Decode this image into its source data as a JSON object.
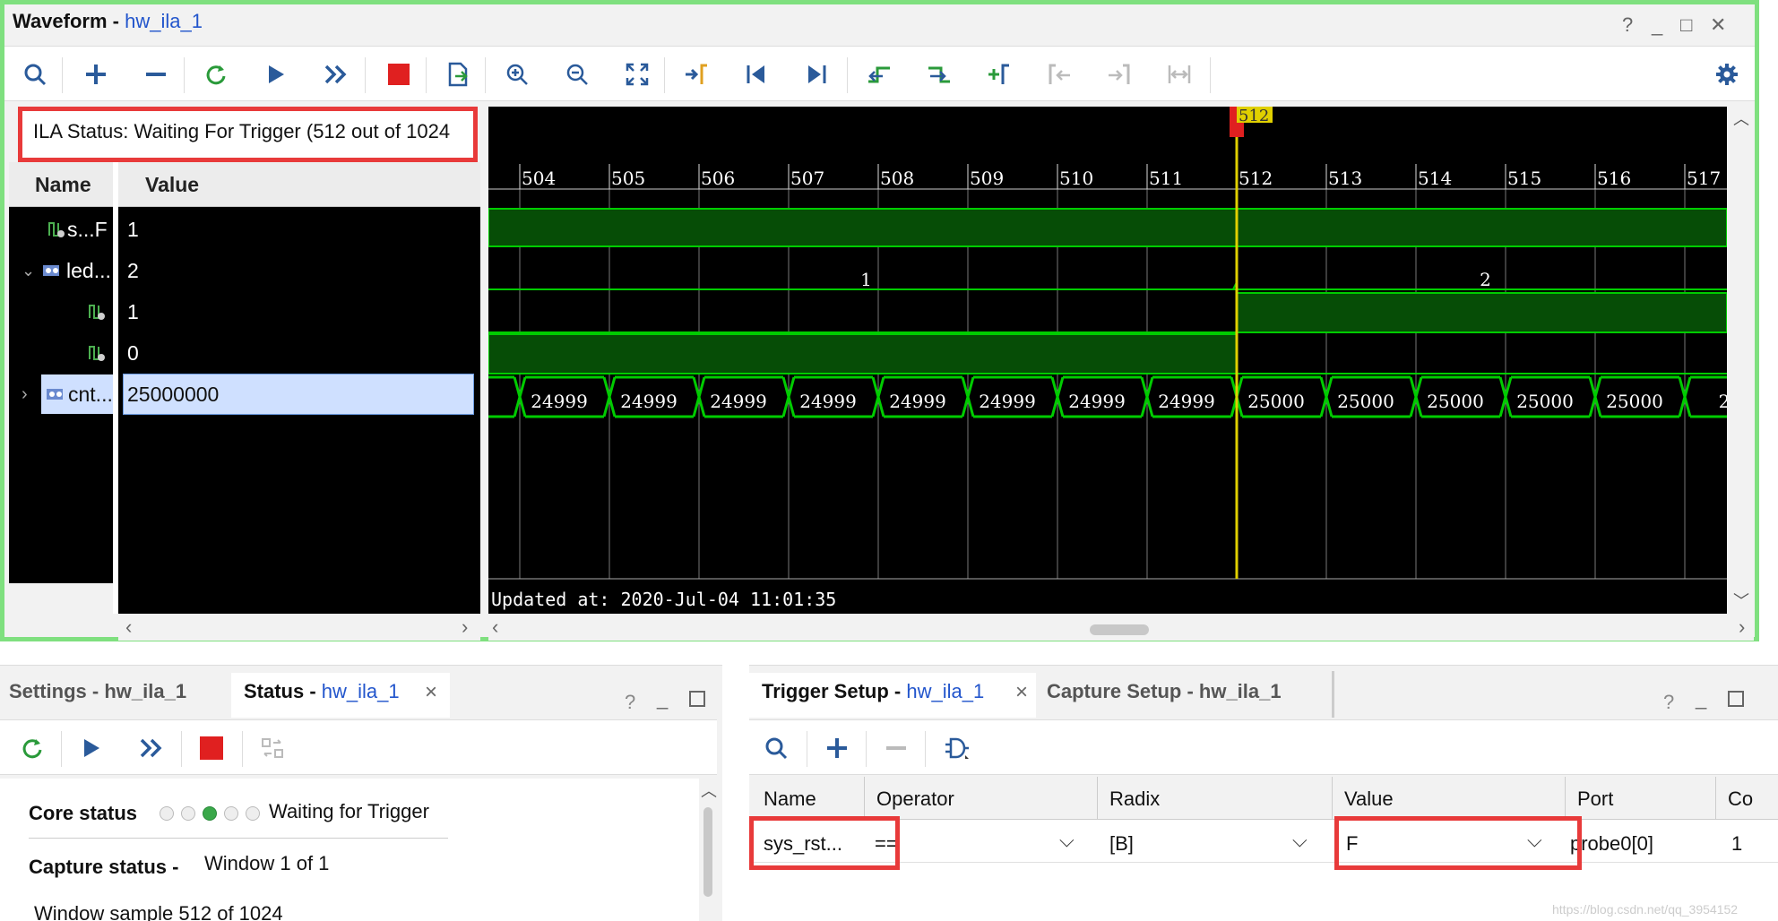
{
  "waveform": {
    "title": "Waveform - ",
    "subtitle": "hw_ila_1",
    "help_label": "?",
    "minimize_label": "_",
    "maximize_label": "□",
    "close_label": "✕",
    "ila_status": "ILA Status:  Waiting For Trigger (512 out of 1024",
    "name_header": "Name",
    "value_header": "Value",
    "signals": [
      {
        "name": "s...F",
        "value": "1",
        "icon": "signal-icon"
      },
      {
        "name": "led...",
        "value": "2",
        "icon": "bus-icon",
        "expanded": true
      },
      {
        "name": "",
        "value": "1",
        "icon": "signal-icon"
      },
      {
        "name": "",
        "value": "0",
        "icon": "signal-icon"
      },
      {
        "name": "cnt...",
        "value": "25000000",
        "icon": "bus-icon",
        "expanded": false
      }
    ],
    "marker_label": "512",
    "ticks": [
      "504",
      "505",
      "506",
      "507",
      "508",
      "509",
      "510",
      "511",
      "512",
      "513",
      "514",
      "515",
      "516",
      "517"
    ],
    "led_bus_labels": [
      "1",
      "2"
    ],
    "cnt_values": [
      "24999",
      "24999",
      "24999",
      "24999",
      "24999",
      "24999",
      "24999",
      "24999",
      "25000",
      "25000",
      "25000",
      "25000",
      "25000",
      "2"
    ],
    "updated_at": "Updated at: 2020-Jul-04 11:01:35",
    "signal_color": "#00cc00",
    "marker_color": "#e0d000"
  },
  "status_panel": {
    "tabs": [
      {
        "label": "Settings - hw_ila_1",
        "sub": ""
      },
      {
        "label": "Status - ",
        "sub": "hw_ila_1"
      }
    ],
    "close_label": "×",
    "core_status_label": "Core status",
    "core_status_value": "Waiting for Trigger",
    "capture_status_label": "Capture status -",
    "capture_status_value": "Window 1 of 1",
    "window_sample": "Window sample 512 of 1024"
  },
  "trigger_panel": {
    "tabs": [
      {
        "label": "Trigger Setup - ",
        "sub": "hw_ila_1"
      },
      {
        "label": "Capture Setup - hw_ila_1",
        "sub": ""
      }
    ],
    "columns": [
      "Name",
      "Operator",
      "Radix",
      "Value",
      "Port",
      "Co"
    ],
    "row": {
      "name": "sys_rst...",
      "operator": "==",
      "radix": "[B]",
      "value": "F",
      "port": "probe0[0]",
      "count": "1"
    },
    "watermark": "https://blog.csdn.net/qq_3954152"
  }
}
